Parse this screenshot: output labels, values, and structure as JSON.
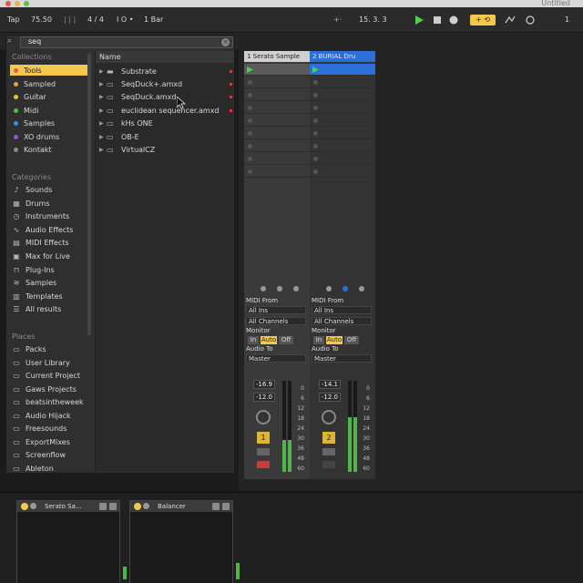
{
  "window": {
    "title": "Untitled",
    "traffic_lights": [
      "#e05a4f",
      "#e6b33c",
      "#5bbf49"
    ]
  },
  "control_bar": {
    "tap": "Tap",
    "tempo": "75.50",
    "signature": "4 / 4",
    "metronome": "I O •",
    "quantize": "1 Bar",
    "position": "15.  3.  3",
    "loop_start": "1",
    "accent_color": "#f2c94c"
  },
  "browser": {
    "search": {
      "value": "seq"
    },
    "collections_header": "Collections",
    "collections": [
      {
        "label": "Tools",
        "color": "#e05a4f",
        "selected": true
      },
      {
        "label": "Sampled",
        "color": "#e6a23c"
      },
      {
        "label": "Guitar",
        "color": "#e6c33c"
      },
      {
        "label": "Midi",
        "color": "#4fbf4a"
      },
      {
        "label": "Samples",
        "color": "#3c8fe6"
      },
      {
        "label": "XO drums",
        "color": "#8e5bd6"
      },
      {
        "label": "Kontakt",
        "color": "#888888"
      }
    ],
    "categories_header": "Categories",
    "categories": [
      {
        "label": "Sounds",
        "icon": "music-note-icon"
      },
      {
        "label": "Drums",
        "icon": "drum-icon"
      },
      {
        "label": "Instruments",
        "icon": "keyboard-icon"
      },
      {
        "label": "Audio Effects",
        "icon": "wave-icon"
      },
      {
        "label": "MIDI Effects",
        "icon": "midi-icon"
      },
      {
        "label": "Max for Live",
        "icon": "max-icon"
      },
      {
        "label": "Plug-Ins",
        "icon": "plug-icon"
      },
      {
        "label": "Samples",
        "icon": "waveform-icon"
      },
      {
        "label": "Templates",
        "icon": "template-icon"
      },
      {
        "label": "All results",
        "icon": "list-icon"
      }
    ],
    "places_header": "Places",
    "places": [
      {
        "label": "Packs"
      },
      {
        "label": "User Library"
      },
      {
        "label": "Current Project"
      },
      {
        "label": "Gaws Projects"
      },
      {
        "label": "beatsintheweek"
      },
      {
        "label": "Audio Hijack"
      },
      {
        "label": "Freesounds"
      },
      {
        "label": "ExportMixes"
      },
      {
        "label": "Screenflow"
      },
      {
        "label": "Ableton"
      }
    ],
    "list_header": "Name",
    "files": [
      {
        "label": "Substrate",
        "icon": "folder-icon"
      },
      {
        "label": "SeqDuck+.amxd",
        "icon": "device-icon"
      },
      {
        "label": "SeqDuck.amxd",
        "icon": "device-icon"
      },
      {
        "label": "euclidean sequencer.amxd",
        "icon": "device-icon"
      },
      {
        "label": "kHs ONE",
        "icon": "device-icon"
      },
      {
        "label": "OB-E",
        "icon": "device-icon"
      },
      {
        "label": "VirtualCZ",
        "icon": "device-icon"
      }
    ]
  },
  "session": {
    "tracks": [
      {
        "title": "1 Serato Sample",
        "title_color": "#d0d0d0",
        "title_text_color": "#222222",
        "midi_from_label": "MIDI From",
        "input": "All Ins",
        "channel": "All Channels",
        "monitor_label": "Monitor",
        "monitor": [
          "In",
          "Auto",
          "Off"
        ],
        "audio_to_label": "Audio To",
        "output": "Master",
        "volume": "-16.9",
        "pan": "-12.0",
        "number": "1",
        "meter_level": 0.35
      },
      {
        "title": "2 BURIAL Dru",
        "title_color": "#2d6fd8",
        "title_text_color": "#e8e8e8",
        "midi_from_label": "MIDI From",
        "input": "All Ins",
        "channel": "All Channels",
        "monitor_label": "Monitor",
        "monitor": [
          "In",
          "Auto",
          "Off"
        ],
        "audio_to_label": "Audio To",
        "output": "Master",
        "volume": "-14.1",
        "pan": "-12.0",
        "number": "2",
        "meter_level": 0.6
      }
    ],
    "meter_scale": [
      "0",
      "6",
      "12",
      "18",
      "24",
      "30",
      "36",
      "48",
      "60"
    ]
  },
  "devices": [
    {
      "title": "Serato Sa...",
      "meter_level": 0.2
    },
    {
      "title": "Balancer",
      "meter_level": 0.25
    }
  ]
}
